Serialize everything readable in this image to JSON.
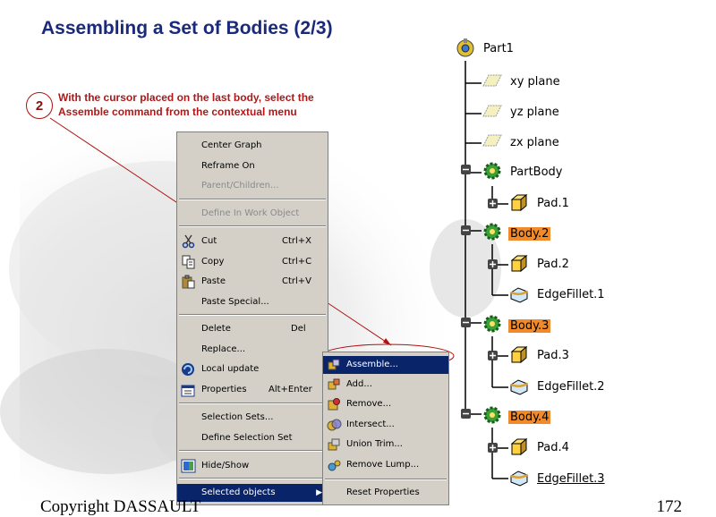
{
  "slide": {
    "title": "Assembling a Set of Bodies (2/3)",
    "step_number": "2",
    "step_line1": "With the cursor placed on the last body, select the",
    "step_line2": "Assemble command from the contextual menu",
    "footer_left": "Copyright DASSAULT",
    "footer_right": "172"
  },
  "context_menu": {
    "items": [
      {
        "label": "Center Graph",
        "shortcut": "",
        "disabled": false,
        "icon": ""
      },
      {
        "label": "Reframe On",
        "shortcut": "",
        "disabled": false,
        "icon": ""
      },
      {
        "label": "Parent/Children...",
        "shortcut": "",
        "disabled": true,
        "icon": ""
      },
      {
        "label": "Define In Work Object",
        "shortcut": "",
        "disabled": true,
        "icon": ""
      },
      {
        "label": "Cut",
        "shortcut": "Ctrl+X",
        "disabled": false,
        "icon": "scissors-icon"
      },
      {
        "label": "Copy",
        "shortcut": "Ctrl+C",
        "disabled": false,
        "icon": "copy-icon"
      },
      {
        "label": "Paste",
        "shortcut": "Ctrl+V",
        "disabled": false,
        "icon": "paste-icon"
      },
      {
        "label": "Paste Special...",
        "shortcut": "",
        "disabled": false,
        "icon": ""
      },
      {
        "label": "Delete",
        "shortcut": "Del",
        "disabled": false,
        "icon": ""
      },
      {
        "label": "Replace...",
        "shortcut": "",
        "disabled": false,
        "icon": ""
      },
      {
        "label": "Local update",
        "shortcut": "",
        "disabled": false,
        "icon": "update-icon"
      },
      {
        "label": "Properties",
        "shortcut": "Alt+Enter",
        "disabled": false,
        "icon": "properties-icon"
      },
      {
        "label": "Selection Sets...",
        "shortcut": "",
        "disabled": false,
        "icon": ""
      },
      {
        "label": "Define Selection Set",
        "shortcut": "",
        "disabled": false,
        "icon": ""
      },
      {
        "label": "Hide/Show",
        "shortcut": "",
        "disabled": false,
        "icon": "hide-show-icon"
      },
      {
        "label": "Selected objects",
        "shortcut": "",
        "disabled": false,
        "icon": ""
      }
    ]
  },
  "submenu": {
    "items": [
      {
        "label": "Assemble...",
        "icon": "assemble-icon"
      },
      {
        "label": "Add...",
        "icon": "add-icon"
      },
      {
        "label": "Remove...",
        "icon": "remove-icon"
      },
      {
        "label": "Intersect...",
        "icon": "intersect-icon"
      },
      {
        "label": "Union Trim...",
        "icon": "union-trim-icon"
      },
      {
        "label": "Remove Lump...",
        "icon": "remove-lump-icon"
      },
      {
        "label": "Reset Properties",
        "icon": ""
      }
    ]
  },
  "tree": {
    "nodes": [
      {
        "label": "Part1",
        "icon": "part-icon",
        "highlight": false
      },
      {
        "label": "xy plane",
        "icon": "plane-icon",
        "highlight": false
      },
      {
        "label": "yz plane",
        "icon": "plane-icon",
        "highlight": false
      },
      {
        "label": "zx plane",
        "icon": "plane-icon",
        "highlight": false
      },
      {
        "label": "PartBody",
        "icon": "body-gear-icon",
        "highlight": false
      },
      {
        "label": "Pad.1",
        "icon": "pad-icon",
        "highlight": false
      },
      {
        "label": "Body.2",
        "icon": "body-gear-icon",
        "highlight": true
      },
      {
        "label": "Pad.2",
        "icon": "pad-icon",
        "highlight": false
      },
      {
        "label": "EdgeFillet.1",
        "icon": "fillet-icon",
        "highlight": false
      },
      {
        "label": "Body.3",
        "icon": "body-gear-icon",
        "highlight": true
      },
      {
        "label": "Pad.3",
        "icon": "pad-icon",
        "highlight": false
      },
      {
        "label": "EdgeFillet.2",
        "icon": "fillet-icon",
        "highlight": false
      },
      {
        "label": "Body.4",
        "icon": "body-gear-icon",
        "highlight": true
      },
      {
        "label": "Pad.4",
        "icon": "pad-icon",
        "highlight": false
      },
      {
        "label": "EdgeFillet.3",
        "icon": "fillet-icon",
        "highlight": false
      }
    ]
  },
  "colors": {
    "title": "#1a2a7a",
    "step_text": "#b01818",
    "menu_bg": "#d4d0c8",
    "selection": "#0a246a",
    "body_highlight": "#f08a2a"
  }
}
